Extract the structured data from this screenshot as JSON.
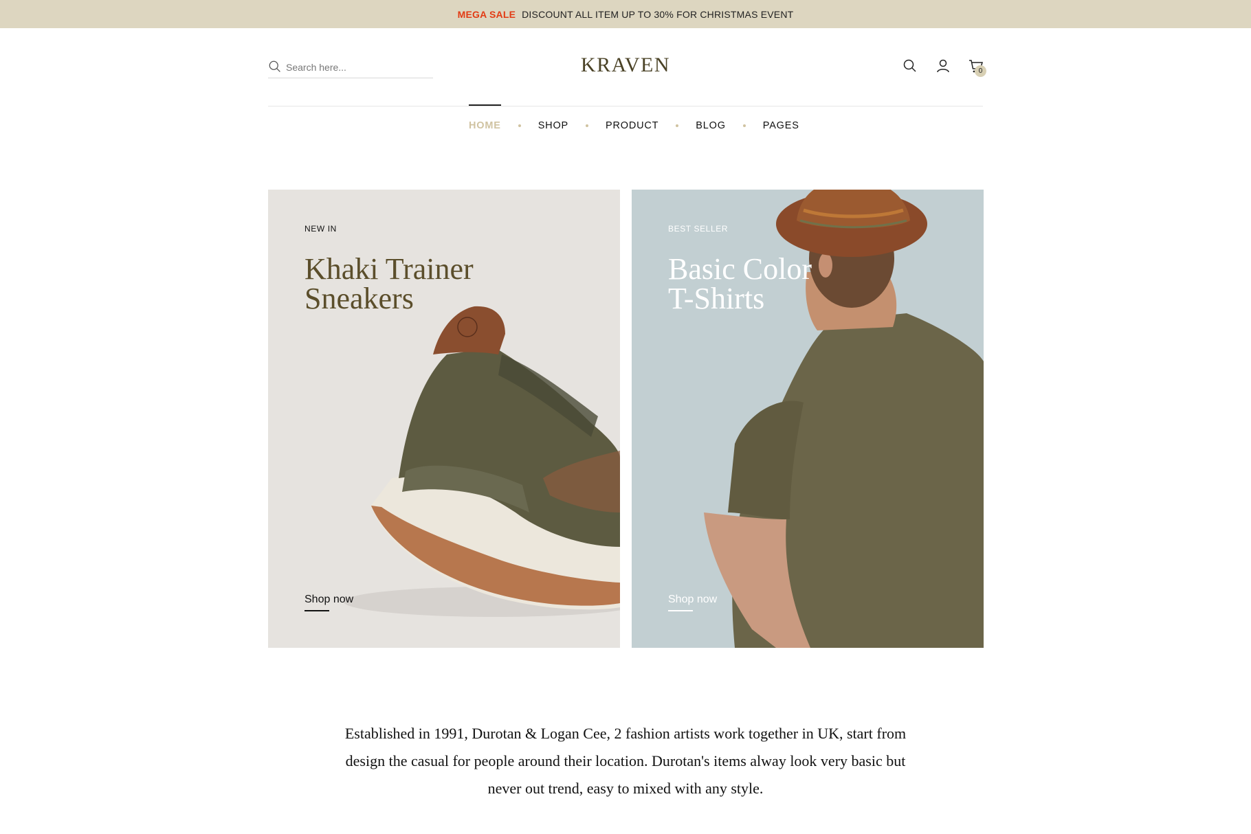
{
  "announcement": {
    "highlight": "MEGA SALE",
    "message": "DISCOUNT ALL ITEM UP TO 30% FOR CHRISTMAS EVENT",
    "highlight_color": "#e23b14",
    "background_color": "#ddd6c0"
  },
  "header": {
    "search_placeholder": "Search here...",
    "logo": "KRAVEN",
    "cart_count": "0",
    "icons": [
      "search-icon",
      "user-icon",
      "cart-icon"
    ]
  },
  "nav": {
    "items": [
      {
        "label": "HOME",
        "active": true
      },
      {
        "label": "SHOP"
      },
      {
        "label": "PRODUCT"
      },
      {
        "label": "BLOG"
      },
      {
        "label": "PAGES"
      }
    ],
    "active_color": "#d0c3a1"
  },
  "banners": [
    {
      "tag": "NEW IN",
      "title_line1": "Khaki Trainer",
      "title_line2": "Sneakers",
      "cta": "Shop now",
      "title_color": "#5b4e2b"
    },
    {
      "tag": "BEST SELLER",
      "title_line1": "Basic Color",
      "title_line2": "T-Shirts",
      "cta": "Shop now",
      "title_color": "#ffffff"
    }
  ],
  "about": {
    "line1": "Established in 1991, Durotan & Logan Cee, 2 fashion artists work together in UK, start from",
    "line2": "design the casual for people around their location. Durotan's items alway look very basic but",
    "line3": "never out trend, easy to mixed with any style."
  }
}
